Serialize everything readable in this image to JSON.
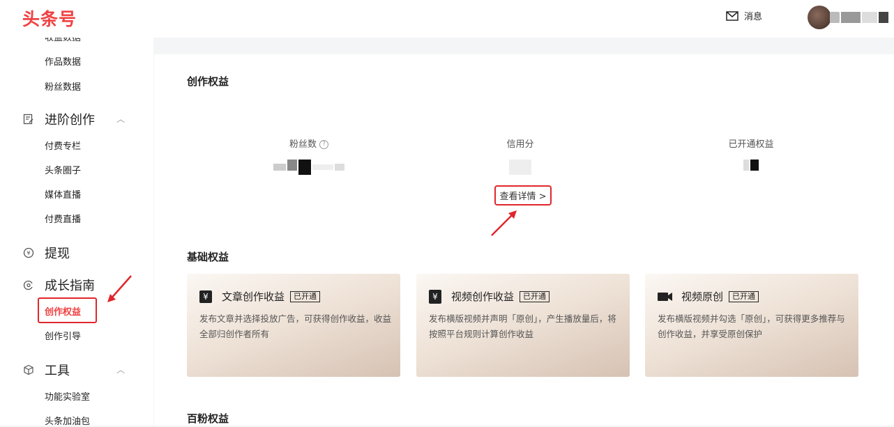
{
  "header": {
    "logo": "头条号",
    "messages_label": "消息"
  },
  "sidebar": {
    "clipped_label": "收益数据",
    "items": [
      {
        "label": "作品数据"
      },
      {
        "label": "粉丝数据"
      }
    ],
    "groups": [
      {
        "label": "进阶创作",
        "icon": "edit-note-icon",
        "children": [
          "付费专栏",
          "头条圈子",
          "媒体直播",
          "付费直播"
        ]
      },
      {
        "label": "提现",
        "icon": "yuan-circle-icon"
      },
      {
        "label": "成长指南",
        "icon": "growth-icon",
        "children": [
          "创作权益",
          "创作引导"
        ]
      },
      {
        "label": "工具",
        "icon": "cube-icon",
        "children": [
          "功能实验室",
          "头条加油包"
        ]
      }
    ],
    "active_item": "创作权益"
  },
  "main": {
    "section_title": "创作权益",
    "stats": [
      {
        "label": "粉丝数"
      },
      {
        "label": "信用分"
      },
      {
        "label": "已开通权益"
      }
    ],
    "detail_link": "查看详情 >",
    "basic_title": "基础权益",
    "cards": [
      {
        "icon": "yuan-icon",
        "title": "文章创作收益",
        "badge": "已开通",
        "desc": "发布文章并选择投放广告，可获得创作收益，收益全部归创作者所有"
      },
      {
        "icon": "tv-yuan-icon",
        "title": "视频创作收益",
        "badge": "已开通",
        "desc": "发布横版视频并声明「原创」，产生播放量后，将按照平台规则计算创作收益"
      },
      {
        "icon": "video-camera-icon",
        "title": "视频原创",
        "badge": "已开通",
        "desc": "发布横版视频并勾选「原创」，可获得更多推荐与创作收益，并享受原创保护"
      }
    ],
    "hundred_fans_title": "百粉权益"
  },
  "colors": {
    "brand": "#f04142",
    "annotation": "#e0262b"
  }
}
